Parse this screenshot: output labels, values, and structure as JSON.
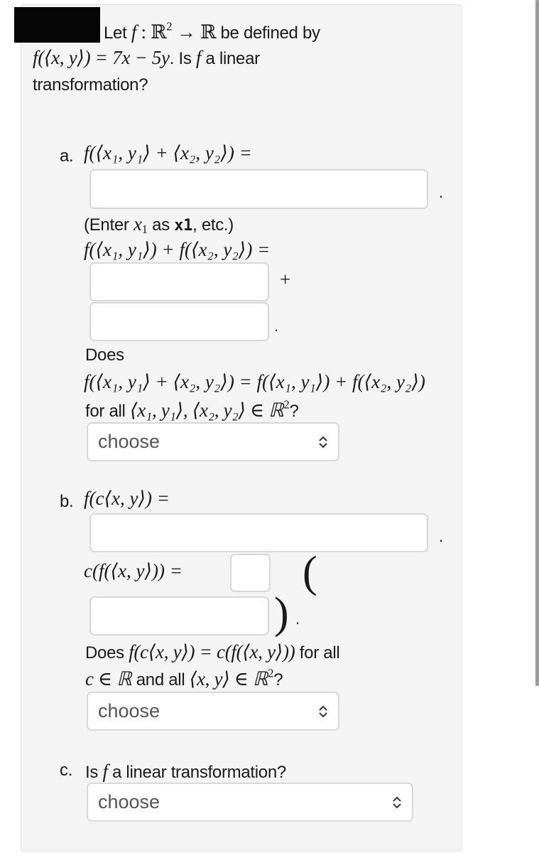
{
  "problem": {
    "intro_1": "Let",
    "intro_f": "f",
    "intro_map": " : ℝ",
    "intro_sup": "2",
    "intro_arrow": " → ℝ",
    "intro_2": " be defined by",
    "def_lhs": "f(⟨x, y⟩) = 7x − 5y",
    "def_tail": ". Is ",
    "def_f": "f",
    "def_tail2": " a linear",
    "line3": "transformation?"
  },
  "part_a": {
    "label": "a.",
    "expr_sum": "f(⟨x",
    "expr_full": "f(⟨x₁, y₁⟩ + ⟨x₂, y₂⟩) =",
    "hint_1": "(Enter ",
    "hint_var": "x",
    "hint_sub": "1",
    "hint_2": " as ",
    "hint_code": "x1",
    "hint_3": ", etc.)",
    "expr_split": "f(⟨x₁, y₁⟩) + f(⟨x₂, y₂⟩) =",
    "plus": "+",
    "question_1": "Does",
    "question_expr": "f(⟨x₁, y₁⟩ + ⟨x₂, y₂⟩) = f(⟨x₁, y₁⟩) + f(⟨x₂, y₂⟩)",
    "question_2": "for all ",
    "question_vars": "⟨x₁, y₁⟩, ⟨x₂, y₂⟩ ∈ ℝ",
    "question_sup": "2",
    "question_end": "?",
    "answer_input_1": "",
    "answer_input_2": "",
    "answer_input_3": "",
    "select_value": "choose"
  },
  "part_b": {
    "label": "b.",
    "expr_scaled": "f(c⟨x, y⟩) =",
    "expr_scalar": "c(f(⟨x, y⟩)) =",
    "open_paren": "(",
    "close_paren": ")",
    "question_1": "Does ",
    "question_expr": "f(c⟨x, y⟩) = c(f(⟨x, y⟩))",
    "question_2": " for all",
    "question_3_c": "c ∈ ℝ",
    "question_3_text": " and all ",
    "question_3_vars": "⟨x, y⟩ ∈ ℝ",
    "question_sup": "2",
    "question_end": "?",
    "answer_input_1": "",
    "answer_input_2": "",
    "answer_input_3": "",
    "select_value": "choose"
  },
  "part_c": {
    "label": "c.",
    "question_1": "Is ",
    "question_f": "f",
    "question_2": " a linear transformation?",
    "select_value": "choose"
  },
  "period": "."
}
